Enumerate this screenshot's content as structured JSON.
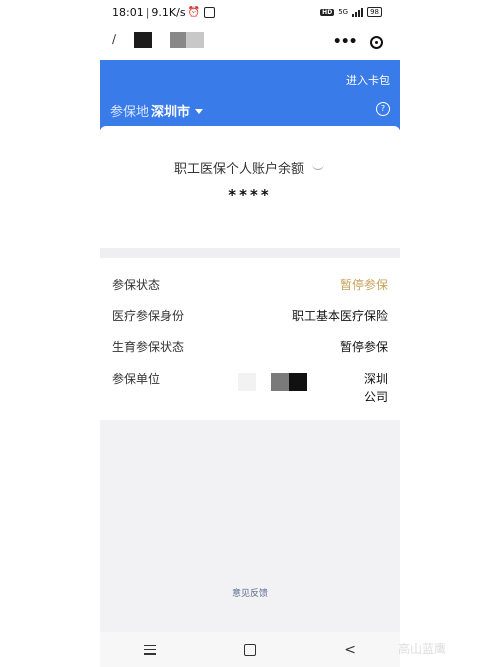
{
  "status_bar": {
    "time": "18:01",
    "net_speed": "9.1K/s",
    "network": "5G",
    "hd": "HD",
    "battery": "98"
  },
  "header": {
    "card_pack": "进入卡包",
    "city_prefix": "参保地",
    "city": "深圳市"
  },
  "balance": {
    "label": "职工医保个人账户余额",
    "value": "****"
  },
  "info": {
    "status_label": "参保状态",
    "status_value": "暂停参保",
    "identity_label": "医疗参保身份",
    "identity_value": "职工基本医疗保险",
    "maternity_label": "生育参保状态",
    "maternity_value": "暂停参保",
    "unit_label": "参保单位",
    "unit_line1": "深圳",
    "unit_line2": "公司"
  },
  "feedback": "意见反馈",
  "watermark": "高山蓝鹰",
  "colors": {
    "header_blue": "#3a7bea",
    "warn_status": "#c9a15c"
  }
}
